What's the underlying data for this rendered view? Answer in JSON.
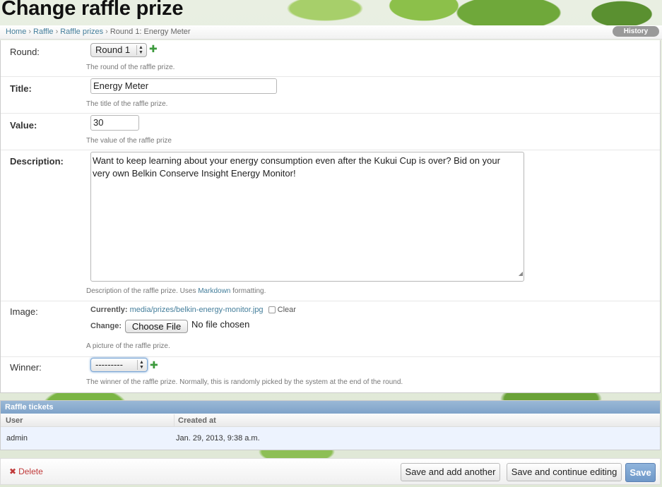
{
  "page_title": "Change raffle prize",
  "breadcrumb": {
    "home": "Home",
    "app": "Raffle",
    "model": "Raffle prizes",
    "current": "Round 1: Energy Meter",
    "sep": "›"
  },
  "history_label": "History",
  "fields": {
    "round": {
      "label": "Round:",
      "value": "Round 1",
      "help": "The round of the raffle prize."
    },
    "title": {
      "label": "Title:",
      "value": "Energy Meter",
      "help": "The title of the raffle prize."
    },
    "value": {
      "label": "Value:",
      "value": "30",
      "help": "The value of the raffle prize"
    },
    "description": {
      "label": "Description:",
      "value_line1": "Want to keep learning about your energy consumption even after the Kukui Cup is over?  Bid on your",
      "value_line2": "very own Belkin Conserve Insight Energy Monitor!",
      "help_prefix": "Description of the raffle prize. Uses ",
      "help_link": "Markdown",
      "help_suffix": " formatting."
    },
    "image": {
      "label": "Image:",
      "currently_label": "Currently:",
      "current_file": "media/prizes/belkin-energy-monitor.jpg",
      "clear_label": "Clear",
      "change_label": "Change:",
      "choose_button": "Choose File",
      "no_file": "No file chosen",
      "help": "A picture of the raffle prize."
    },
    "winner": {
      "label": "Winner:",
      "value": "---------",
      "help": "The winner of the raffle prize. Normally, this is randomly picked by the system at the end of the round."
    }
  },
  "inline": {
    "title": "Raffle tickets",
    "columns": [
      "User",
      "Created at"
    ],
    "rows": [
      {
        "user": "admin",
        "created_at": "Jan. 29, 2013, 9:38 a.m."
      }
    ]
  },
  "actions": {
    "delete": "Delete",
    "delete_icon": "✖",
    "save_add": "Save and add another",
    "save_continue": "Save and continue editing",
    "save": "Save"
  },
  "plus_icon": "✚",
  "arrows_icon": "▲▼"
}
